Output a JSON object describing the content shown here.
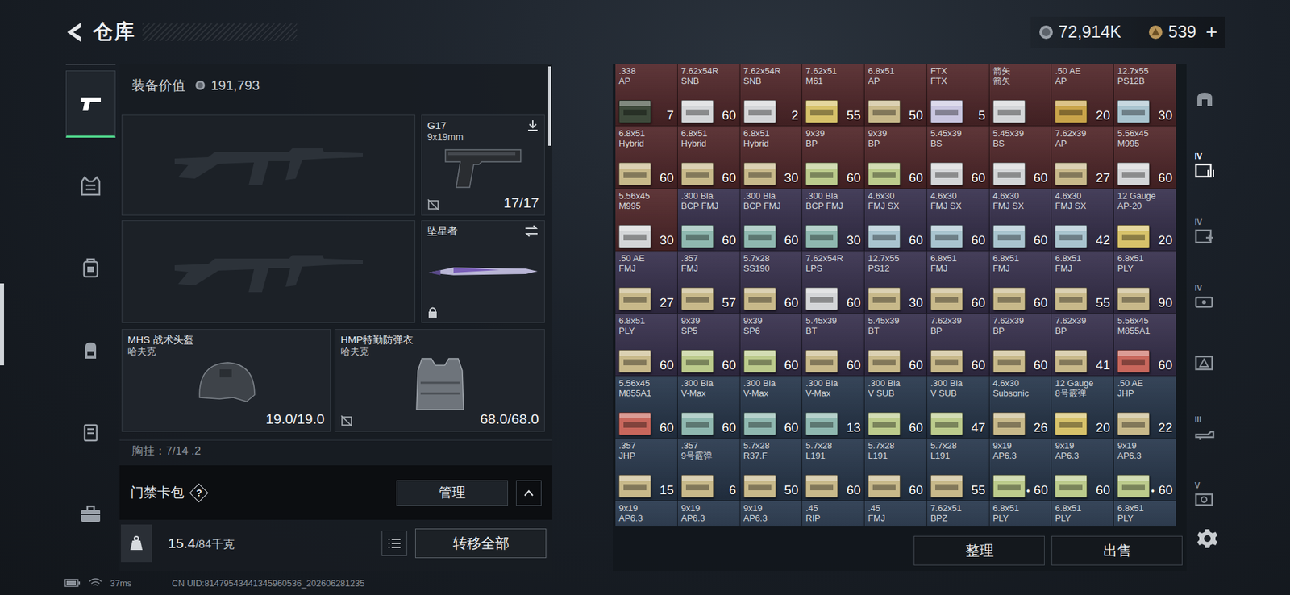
{
  "header": {
    "title": "仓库"
  },
  "currency": [
    {
      "amount": "72,914K",
      "kind": "coin",
      "plus": ""
    },
    {
      "amount": "539",
      "kind": "gold",
      "plus": "+"
    }
  ],
  "nav": [
    {
      "selected": true
    },
    {
      "selected": false
    },
    {
      "selected": false
    },
    {
      "selected": false
    },
    {
      "selected": false
    },
    {
      "selected": false
    }
  ],
  "equipment": {
    "value_label": "装备价值",
    "value": "191,793"
  },
  "loadout": {
    "primary_slots": [
      {
        "empty": true
      },
      {
        "empty": true
      }
    ],
    "pistol": {
      "name": "G17",
      "caliber": "9x19mm",
      "ammo": "17/17",
      "insured": false
    },
    "melee": {
      "name": "坠星者",
      "locked": true
    },
    "helmet": {
      "name": "MHS 战术头盔",
      "brand": "哈夫克",
      "durability": "19.0/19.0",
      "insured": true
    },
    "armor": {
      "name": "HMP特勤防弹衣",
      "brand": "哈夫克",
      "durability": "68.0/68.0",
      "insured": false
    },
    "chest_rig": "胸挂：7/14 .2"
  },
  "card_pack": {
    "label": "门禁卡包",
    "help": "?",
    "button": "管理"
  },
  "weight": {
    "current": "15.4",
    "max": "/84千克"
  },
  "transfer_button": "转移全部",
  "stash": [
    {
      "caliber": ".338",
      "type": "AP",
      "count": "7",
      "mark": "",
      "tier": "#552a2d",
      "box": "#3e4a3b"
    },
    {
      "caliber": "7.62x54R",
      "type": "SNB",
      "count": "60",
      "mark": "",
      "tier": "#552a2d",
      "box": "#d4d6d8"
    },
    {
      "caliber": "7.62x54R",
      "type": "SNB",
      "count": "2",
      "mark": "",
      "tier": "#552a2d",
      "box": "#d4d6d8"
    },
    {
      "caliber": "7.62x51",
      "type": "M61",
      "count": "55",
      "mark": "",
      "tier": "#552a2d",
      "box": "#d7c26a"
    },
    {
      "caliber": "6.8x51",
      "type": "AP",
      "count": "50",
      "mark": "",
      "tier": "#552a2d",
      "box": "#c8b98a"
    },
    {
      "caliber": "FTX",
      "type": "FTX",
      "count": "5",
      "mark": "",
      "tier": "#552a2d",
      "box": "#c9c6e0"
    },
    {
      "caliber": "箭矢",
      "type": "箭矢",
      "count": "",
      "mark": "",
      "tier": "#552a2d",
      "box": "#d4d6d8"
    },
    {
      "caliber": ".50 AE",
      "type": "AP",
      "count": "20",
      "mark": "",
      "tier": "#552a2d",
      "box": "#c9a44a"
    },
    {
      "caliber": "12.7x55",
      "type": "PS12B",
      "count": "30",
      "mark": "",
      "tier": "#552a2d",
      "box": "#a9c4cf"
    },
    {
      "caliber": "6.8x51",
      "type": "Hybrid",
      "count": "60",
      "mark": "",
      "tier": "#552a2d",
      "box": "#c8b98a"
    },
    {
      "caliber": "6.8x51",
      "type": "Hybrid",
      "count": "60",
      "mark": "",
      "tier": "#552a2d",
      "box": "#c8b98a"
    },
    {
      "caliber": "6.8x51",
      "type": "Hybrid",
      "count": "30",
      "mark": "",
      "tier": "#552a2d",
      "box": "#c8b98a"
    },
    {
      "caliber": "9x39",
      "type": "BP",
      "count": "60",
      "mark": "",
      "tier": "#552a2d",
      "box": "#bccb8c"
    },
    {
      "caliber": "9x39",
      "type": "BP",
      "count": "60",
      "mark": "",
      "tier": "#552a2d",
      "box": "#bccb8c"
    },
    {
      "caliber": "5.45x39",
      "type": "BS",
      "count": "60",
      "mark": "",
      "tier": "#552a2d",
      "box": "#d4d6d8"
    },
    {
      "caliber": "5.45x39",
      "type": "BS",
      "count": "60",
      "mark": "",
      "tier": "#552a2d",
      "box": "#d4d6d8"
    },
    {
      "caliber": "7.62x39",
      "type": "AP",
      "count": "27",
      "mark": "",
      "tier": "#552a2d",
      "box": "#c8b98a"
    },
    {
      "caliber": "5.56x45",
      "type": "M995",
      "count": "60",
      "mark": "",
      "tier": "#552a2d",
      "box": "#d4d6d8"
    },
    {
      "caliber": "5.56x45",
      "type": "M995",
      "count": "30",
      "mark": "",
      "tier": "#552a2d",
      "box": "#d4d6d8"
    },
    {
      "caliber": ".300 Bla",
      "type": "BCP FMJ",
      "count": "60",
      "mark": "",
      "tier": "#3a3350",
      "box": "#8fb8b0"
    },
    {
      "caliber": ".300 Bla",
      "type": "BCP FMJ",
      "count": "60",
      "mark": "",
      "tier": "#3a3350",
      "box": "#8fb8b0"
    },
    {
      "caliber": ".300 Bla",
      "type": "BCP FMJ",
      "count": "30",
      "mark": "",
      "tier": "#3a3350",
      "box": "#8fb8b0"
    },
    {
      "caliber": "4.6x30",
      "type": "FMJ SX",
      "count": "60",
      "mark": "",
      "tier": "#3a3350",
      "box": "#a9c4cf"
    },
    {
      "caliber": "4.6x30",
      "type": "FMJ SX",
      "count": "60",
      "mark": "",
      "tier": "#3a3350",
      "box": "#a9c4cf"
    },
    {
      "caliber": "4.6x30",
      "type": "FMJ SX",
      "count": "60",
      "mark": "",
      "tier": "#3a3350",
      "box": "#a9c4cf"
    },
    {
      "caliber": "4.6x30",
      "type": "FMJ SX",
      "count": "42",
      "mark": "",
      "tier": "#3a3350",
      "box": "#a9c4cf"
    },
    {
      "caliber": "12 Gauge",
      "type": "AP-20",
      "count": "20",
      "mark": "",
      "tier": "#3a3350",
      "box": "#d7c26a"
    },
    {
      "caliber": ".50 AE",
      "type": "FMJ",
      "count": "27",
      "mark": "",
      "tier": "#3a3350",
      "box": "#c8b98a"
    },
    {
      "caliber": ".357",
      "type": "FMJ",
      "count": "57",
      "mark": "",
      "tier": "#3a3350",
      "box": "#c8b98a"
    },
    {
      "caliber": "5.7x28",
      "type": "SS190",
      "count": "60",
      "mark": "",
      "tier": "#3a3350",
      "box": "#c8b98a"
    },
    {
      "caliber": "7.62x54R",
      "type": "LPS",
      "count": "60",
      "mark": "",
      "tier": "#3a3350",
      "box": "#d4d6d8"
    },
    {
      "caliber": "12.7x55",
      "type": "PS12",
      "count": "30",
      "mark": "",
      "tier": "#3a3350",
      "box": "#c8b98a"
    },
    {
      "caliber": "6.8x51",
      "type": "FMJ",
      "count": "60",
      "mark": "",
      "tier": "#3a3350",
      "box": "#c8b98a"
    },
    {
      "caliber": "6.8x51",
      "type": "FMJ",
      "count": "60",
      "mark": "",
      "tier": "#3a3350",
      "box": "#c8b98a"
    },
    {
      "caliber": "6.8x51",
      "type": "FMJ",
      "count": "55",
      "mark": "",
      "tier": "#3a3350",
      "box": "#c8b98a"
    },
    {
      "caliber": "6.8x51",
      "type": "PLY",
      "count": "90",
      "mark": "",
      "tier": "#3a3350",
      "box": "#c8b98a"
    },
    {
      "caliber": "6.8x51",
      "type": "PLY",
      "count": "60",
      "mark": "",
      "tier": "#3a3350",
      "box": "#c8b98a"
    },
    {
      "caliber": "9x39",
      "type": "SP5",
      "count": "60",
      "mark": "",
      "tier": "#3a3350",
      "box": "#bccb8c"
    },
    {
      "caliber": "9x39",
      "type": "SP6",
      "count": "60",
      "mark": "",
      "tier": "#3a3350",
      "box": "#bccb8c"
    },
    {
      "caliber": "5.45x39",
      "type": "BT",
      "count": "60",
      "mark": "",
      "tier": "#3a3350",
      "box": "#c8b98a"
    },
    {
      "caliber": "5.45x39",
      "type": "BT",
      "count": "60",
      "mark": "",
      "tier": "#3a3350",
      "box": "#c8b98a"
    },
    {
      "caliber": "7.62x39",
      "type": "BP",
      "count": "60",
      "mark": "",
      "tier": "#3a3350",
      "box": "#c8b98a"
    },
    {
      "caliber": "7.62x39",
      "type": "BP",
      "count": "60",
      "mark": "",
      "tier": "#3a3350",
      "box": "#c8b98a"
    },
    {
      "caliber": "7.62x39",
      "type": "BP",
      "count": "41",
      "mark": "",
      "tier": "#3a3350",
      "box": "#c8b98a"
    },
    {
      "caliber": "5.56x45",
      "type": "M855A1",
      "count": "60",
      "mark": "",
      "tier": "#3a3350",
      "box": "#c8675c"
    },
    {
      "caliber": "5.56x45",
      "type": "M855A1",
      "count": "60",
      "mark": "",
      "tier": "#2a3a4f",
      "box": "#c8675c"
    },
    {
      "caliber": ".300 Bla",
      "type": "V-Max",
      "count": "60",
      "mark": "",
      "tier": "#2a3a4f",
      "box": "#8fb8b0"
    },
    {
      "caliber": ".300 Bla",
      "type": "V-Max",
      "count": "60",
      "mark": "",
      "tier": "#2a3a4f",
      "box": "#8fb8b0"
    },
    {
      "caliber": ".300 Bla",
      "type": "V-Max",
      "count": "13",
      "mark": "",
      "tier": "#2a3a4f",
      "box": "#8fb8b0"
    },
    {
      "caliber": ".300 Bla",
      "type": "V SUB",
      "count": "60",
      "mark": "",
      "tier": "#2a3a4f",
      "box": "#bccb8c"
    },
    {
      "caliber": ".300 Bla",
      "type": "V SUB",
      "count": "47",
      "mark": "",
      "tier": "#2a3a4f",
      "box": "#bccb8c"
    },
    {
      "caliber": "4.6x30",
      "type": "Subsonic",
      "count": "26",
      "mark": "",
      "tier": "#2a3a4f",
      "box": "#c8b98a"
    },
    {
      "caliber": "12 Gauge",
      "type": "8号霰弹",
      "count": "20",
      "mark": "",
      "tier": "#2a3a4f",
      "box": "#d7c26a"
    },
    {
      "caliber": ".50 AE",
      "type": "JHP",
      "count": "22",
      "mark": "",
      "tier": "#2a3a4f",
      "box": "#c8b98a"
    },
    {
      "caliber": ".357",
      "type": "JHP",
      "count": "15",
      "mark": "",
      "tier": "#2a3a4f",
      "box": "#c8b98a"
    },
    {
      "caliber": ".357",
      "type": "9号霰弹",
      "count": "6",
      "mark": "",
      "tier": "#2a3a4f",
      "box": "#c8b98a"
    },
    {
      "caliber": "5.7x28",
      "type": "R37.F",
      "count": "50",
      "mark": "",
      "tier": "#2a3a4f",
      "box": "#c8b98a"
    },
    {
      "caliber": "5.7x28",
      "type": "L191",
      "count": "60",
      "mark": "",
      "tier": "#2a3a4f",
      "box": "#c8b98a"
    },
    {
      "caliber": "5.7x28",
      "type": "L191",
      "count": "60",
      "mark": "",
      "tier": "#2a3a4f",
      "box": "#c8b98a"
    },
    {
      "caliber": "5.7x28",
      "type": "L191",
      "count": "55",
      "mark": "",
      "tier": "#2a3a4f",
      "box": "#c8b98a"
    },
    {
      "caliber": "9x19",
      "type": "AP6.3",
      "count": "60",
      "mark": "•",
      "tier": "#2a3a4f",
      "box": "#bccb8c"
    },
    {
      "caliber": "9x19",
      "type": "AP6.3",
      "count": "60",
      "mark": "",
      "tier": "#2a3a4f",
      "box": "#bccb8c"
    },
    {
      "caliber": "9x19",
      "type": "AP6.3",
      "count": "60",
      "mark": "•",
      "tier": "#2a3a4f",
      "box": "#bccb8c"
    },
    {
      "caliber": "9x19",
      "type": "AP6.3",
      "count": "",
      "mark": "",
      "tier": "#2a3a4f",
      "box": "#bccb8c"
    },
    {
      "caliber": "9x19",
      "type": "AP6.3",
      "count": "",
      "mark": "",
      "tier": "#2a3a4f",
      "box": "#bccb8c"
    },
    {
      "caliber": "9x19",
      "type": "AP6.3",
      "count": "",
      "mark": "",
      "tier": "#2a3a4f",
      "box": "#bccb8c"
    },
    {
      "caliber": ".45",
      "type": "RIP",
      "count": "",
      "mark": "",
      "tier": "#2a3a4f",
      "box": "#c8b98a"
    },
    {
      "caliber": ".45",
      "type": "FMJ",
      "count": "",
      "mark": "",
      "tier": "#2a3a4f",
      "box": "#c8b98a"
    },
    {
      "caliber": "7.62x51",
      "type": "BPZ",
      "count": "",
      "mark": "",
      "tier": "#2a3a4f",
      "box": "#c8b98a"
    },
    {
      "caliber": "6.8x51",
      "type": "PLY",
      "count": "",
      "mark": "",
      "tier": "#2a3a4f",
      "box": "#c8b98a"
    },
    {
      "caliber": "6.8x51",
      "type": "PLY",
      "count": "",
      "mark": "",
      "tier": "#2a3a4f",
      "box": "#c8b98a"
    },
    {
      "caliber": "6.8x51",
      "type": "PLY",
      "count": "",
      "mark": "",
      "tier": "#2a3a4f",
      "box": "#c8b98a"
    }
  ],
  "actions": [
    "整理",
    "出售"
  ],
  "filters": [
    {
      "label": "",
      "selected": false
    },
    {
      "label": "IV",
      "selected": true
    },
    {
      "label": "IV",
      "selected": false
    },
    {
      "label": "IV",
      "selected": false
    },
    {
      "label": "",
      "selected": false
    },
    {
      "label": "III",
      "selected": false
    },
    {
      "label": "V",
      "selected": false
    }
  ],
  "status": {
    "ping": "37ms",
    "uid": "CN UID:81479543441345960536_202606281235"
  }
}
